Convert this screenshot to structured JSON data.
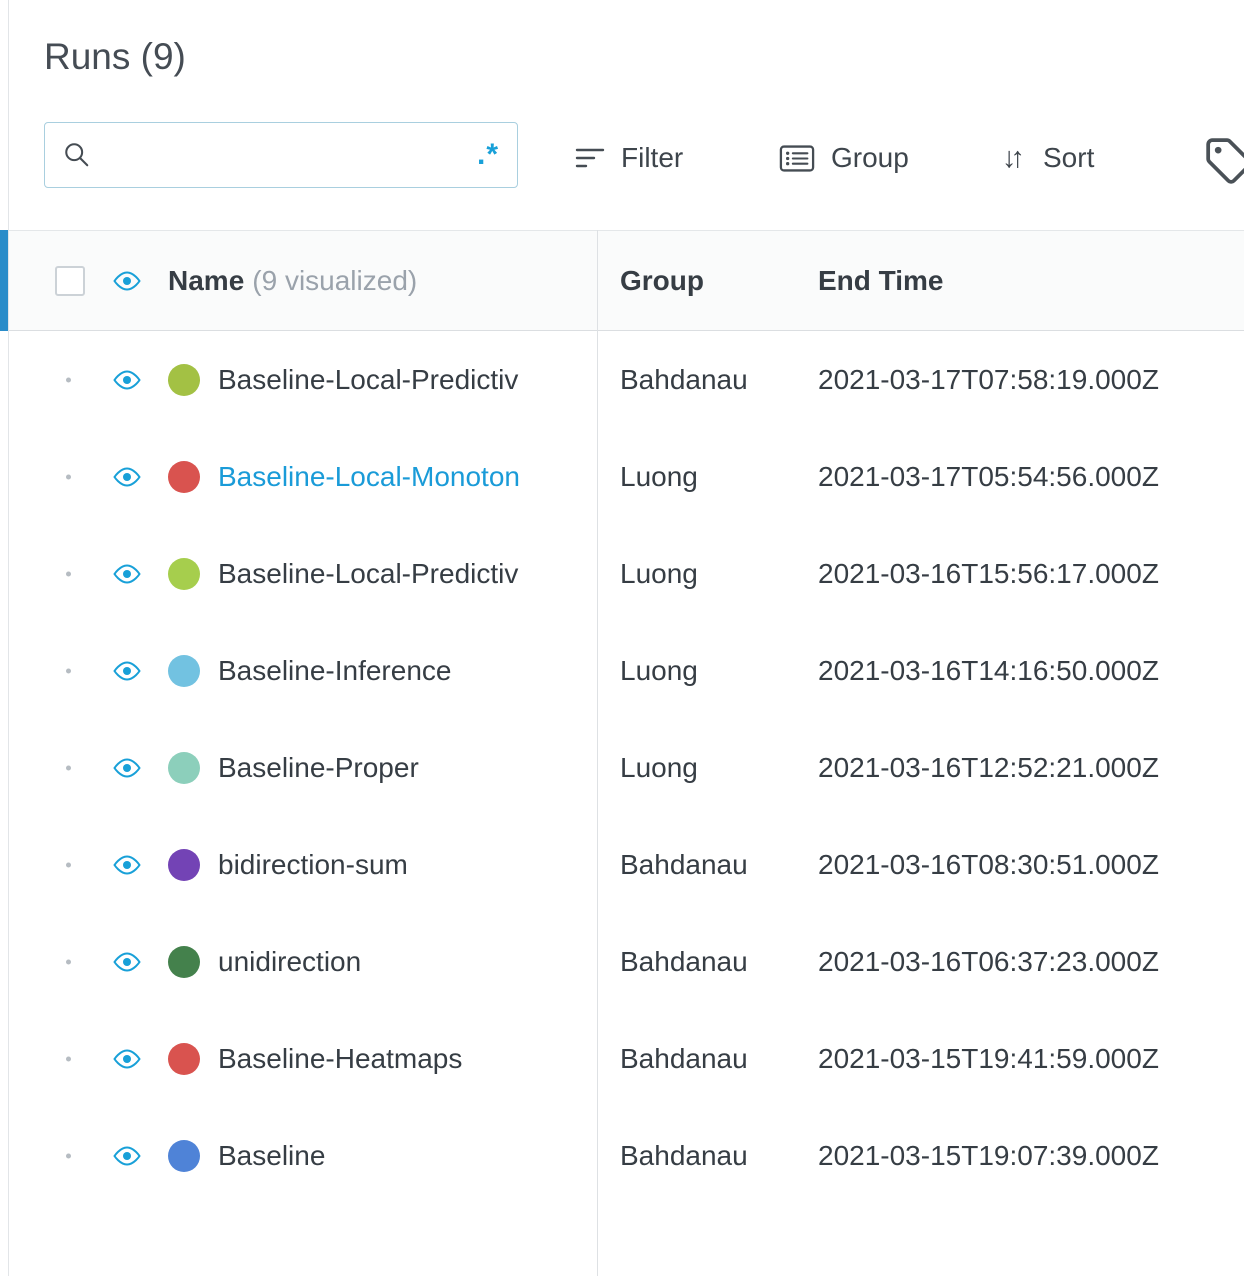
{
  "page": {
    "title": "Runs (9)"
  },
  "search": {
    "value": "",
    "placeholder": "",
    "regex_toggle": ".*"
  },
  "toolbar": {
    "filter_label": "Filter",
    "group_label": "Group",
    "sort_label": "Sort",
    "sort_glyph": "↓↑"
  },
  "table": {
    "header": {
      "name": "Name",
      "name_suffix": "(9 visualized)",
      "group": "Group",
      "end_time": "End Time"
    },
    "rows": [
      {
        "name": "Baseline-Local-Predictiv",
        "dot_color": "#a3c144",
        "group": "Bahdanau",
        "end_time": "2021-03-17T07:58:19.000Z"
      },
      {
        "name": "Baseline-Local-Monoton",
        "dot_color": "#d9534f",
        "group": "Luong",
        "end_time": "2021-03-17T05:54:56.000Z",
        "name_color": "#1a9bd8"
      },
      {
        "name": "Baseline-Local-Predictiv",
        "dot_color": "#a6ce4d",
        "group": "Luong",
        "end_time": "2021-03-16T15:56:17.000Z"
      },
      {
        "name": "Baseline-Inference",
        "dot_color": "#72c2e1",
        "group": "Luong",
        "end_time": "2021-03-16T14:16:50.000Z"
      },
      {
        "name": "Baseline-Proper",
        "dot_color": "#8ccfbb",
        "group": "Luong",
        "end_time": "2021-03-16T12:52:21.000Z"
      },
      {
        "name": "bidirection-sum",
        "dot_color": "#7343b5",
        "group": "Bahdanau",
        "end_time": "2021-03-16T08:30:51.000Z"
      },
      {
        "name": "unidirection",
        "dot_color": "#44814c",
        "group": "Bahdanau",
        "end_time": "2021-03-16T06:37:23.000Z"
      },
      {
        "name": "Baseline-Heatmaps",
        "dot_color": "#d9534f",
        "group": "Bahdanau",
        "end_time": "2021-03-15T19:41:59.000Z"
      },
      {
        "name": "Baseline",
        "dot_color": "#4f83d7",
        "group": "Bahdanau",
        "end_time": "2021-03-15T19:07:39.000Z"
      }
    ]
  },
  "colors": {
    "accent_bar": "#2a8cc9",
    "icon_blue": "#18a0d8",
    "link_blue": "#1a9bd8"
  }
}
